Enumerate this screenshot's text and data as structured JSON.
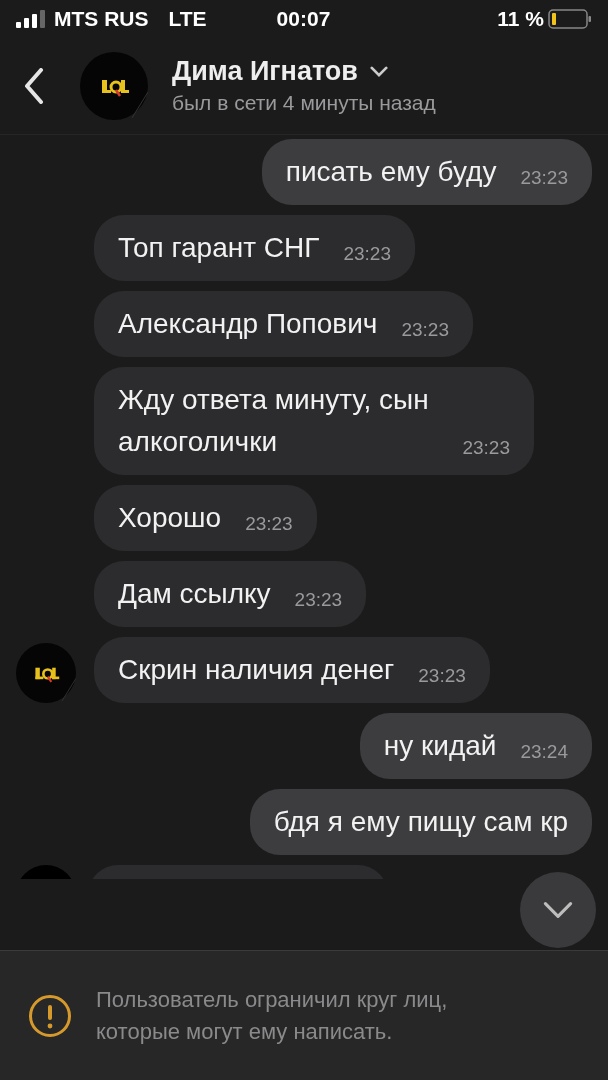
{
  "status_bar": {
    "carrier": "MTS RUS",
    "network": "LTE",
    "time": "00:07",
    "battery": "11 %"
  },
  "header": {
    "name": "Дима Игнатов",
    "status": "был в сети 4 минуты назад"
  },
  "messages": [
    {
      "kind": "outgoing",
      "text": "писать ему буду",
      "time": "23:23"
    },
    {
      "kind": "incoming",
      "text": "Топ гарант СНГ",
      "time": "23:23",
      "avatar": false
    },
    {
      "kind": "incoming",
      "text": "Александр Попович",
      "time": "23:23",
      "avatar": false
    },
    {
      "kind": "incoming",
      "text": "Жду ответа минуту, сын алкоголички",
      "time": "23:23",
      "avatar": false
    },
    {
      "kind": "incoming",
      "text": "Хорошо",
      "time": "23:23",
      "avatar": false
    },
    {
      "kind": "incoming",
      "text": "Дам ссылку",
      "time": "23:23",
      "avatar": false
    },
    {
      "kind": "incoming",
      "text": "Скрин наличия денег",
      "time": "23:23",
      "avatar": true
    },
    {
      "kind": "outgoing",
      "text": "ну кидай",
      "time": "23:24"
    },
    {
      "kind": "outgoing",
      "text": "бдя я ему пищу сам кр"
    },
    {
      "kind": "incoming",
      "avatar": true
    }
  ],
  "notice": {
    "text": "Пользователь ограничил круг лиц, которые могут ему написать."
  }
}
